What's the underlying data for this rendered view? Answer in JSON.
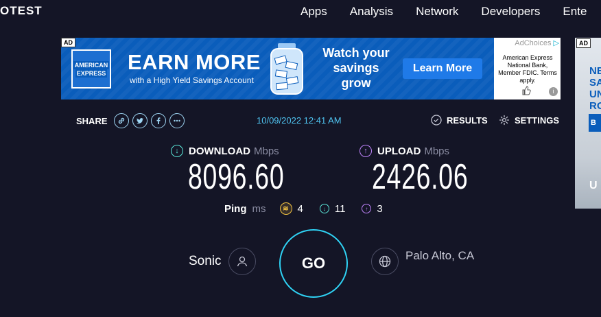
{
  "header": {
    "logo": "OTEST",
    "nav": [
      "Apps",
      "Analysis",
      "Network",
      "Developers",
      "Ente"
    ]
  },
  "ad_main": {
    "tag": "AD",
    "amex_line1": "AMERICAN",
    "amex_line2": "EXPRESS",
    "headline": "EARN MORE",
    "subline": "with a High Yield Savings Account",
    "watch_line1": "Watch your",
    "watch_line2": "savings",
    "watch_line3": "grow",
    "cta": "Learn More",
    "adchoices": "AdChoices",
    "disclosure": "American Express National Bank, Member FDIC. Terms apply.",
    "info": "i"
  },
  "ad_side": {
    "tag": "AD",
    "text_lines": [
      "NE",
      "SA",
      "UN",
      "RO"
    ],
    "button": "B",
    "bottom": "U"
  },
  "share_bar": {
    "share_label": "SHARE",
    "timestamp": "10/09/2022 12:41 AM",
    "results_label": "RESULTS",
    "settings_label": "SETTINGS"
  },
  "download": {
    "label": "DOWNLOAD",
    "unit": "Mbps",
    "value": "8096.60"
  },
  "upload": {
    "label": "UPLOAD",
    "unit": "Mbps",
    "value": "2426.06"
  },
  "ping": {
    "label": "Ping",
    "unit": "ms",
    "idle": "4",
    "download": "11",
    "upload": "3"
  },
  "server": {
    "isp": "Sonic",
    "go_label": "GO",
    "location": "Palo Alto, CA"
  },
  "colors": {
    "background": "#141526",
    "download_accent": "#5be7d9",
    "upload_accent": "#c084fc",
    "go_ring": "#2fd3f5",
    "timestamp": "#4fc3f0"
  }
}
